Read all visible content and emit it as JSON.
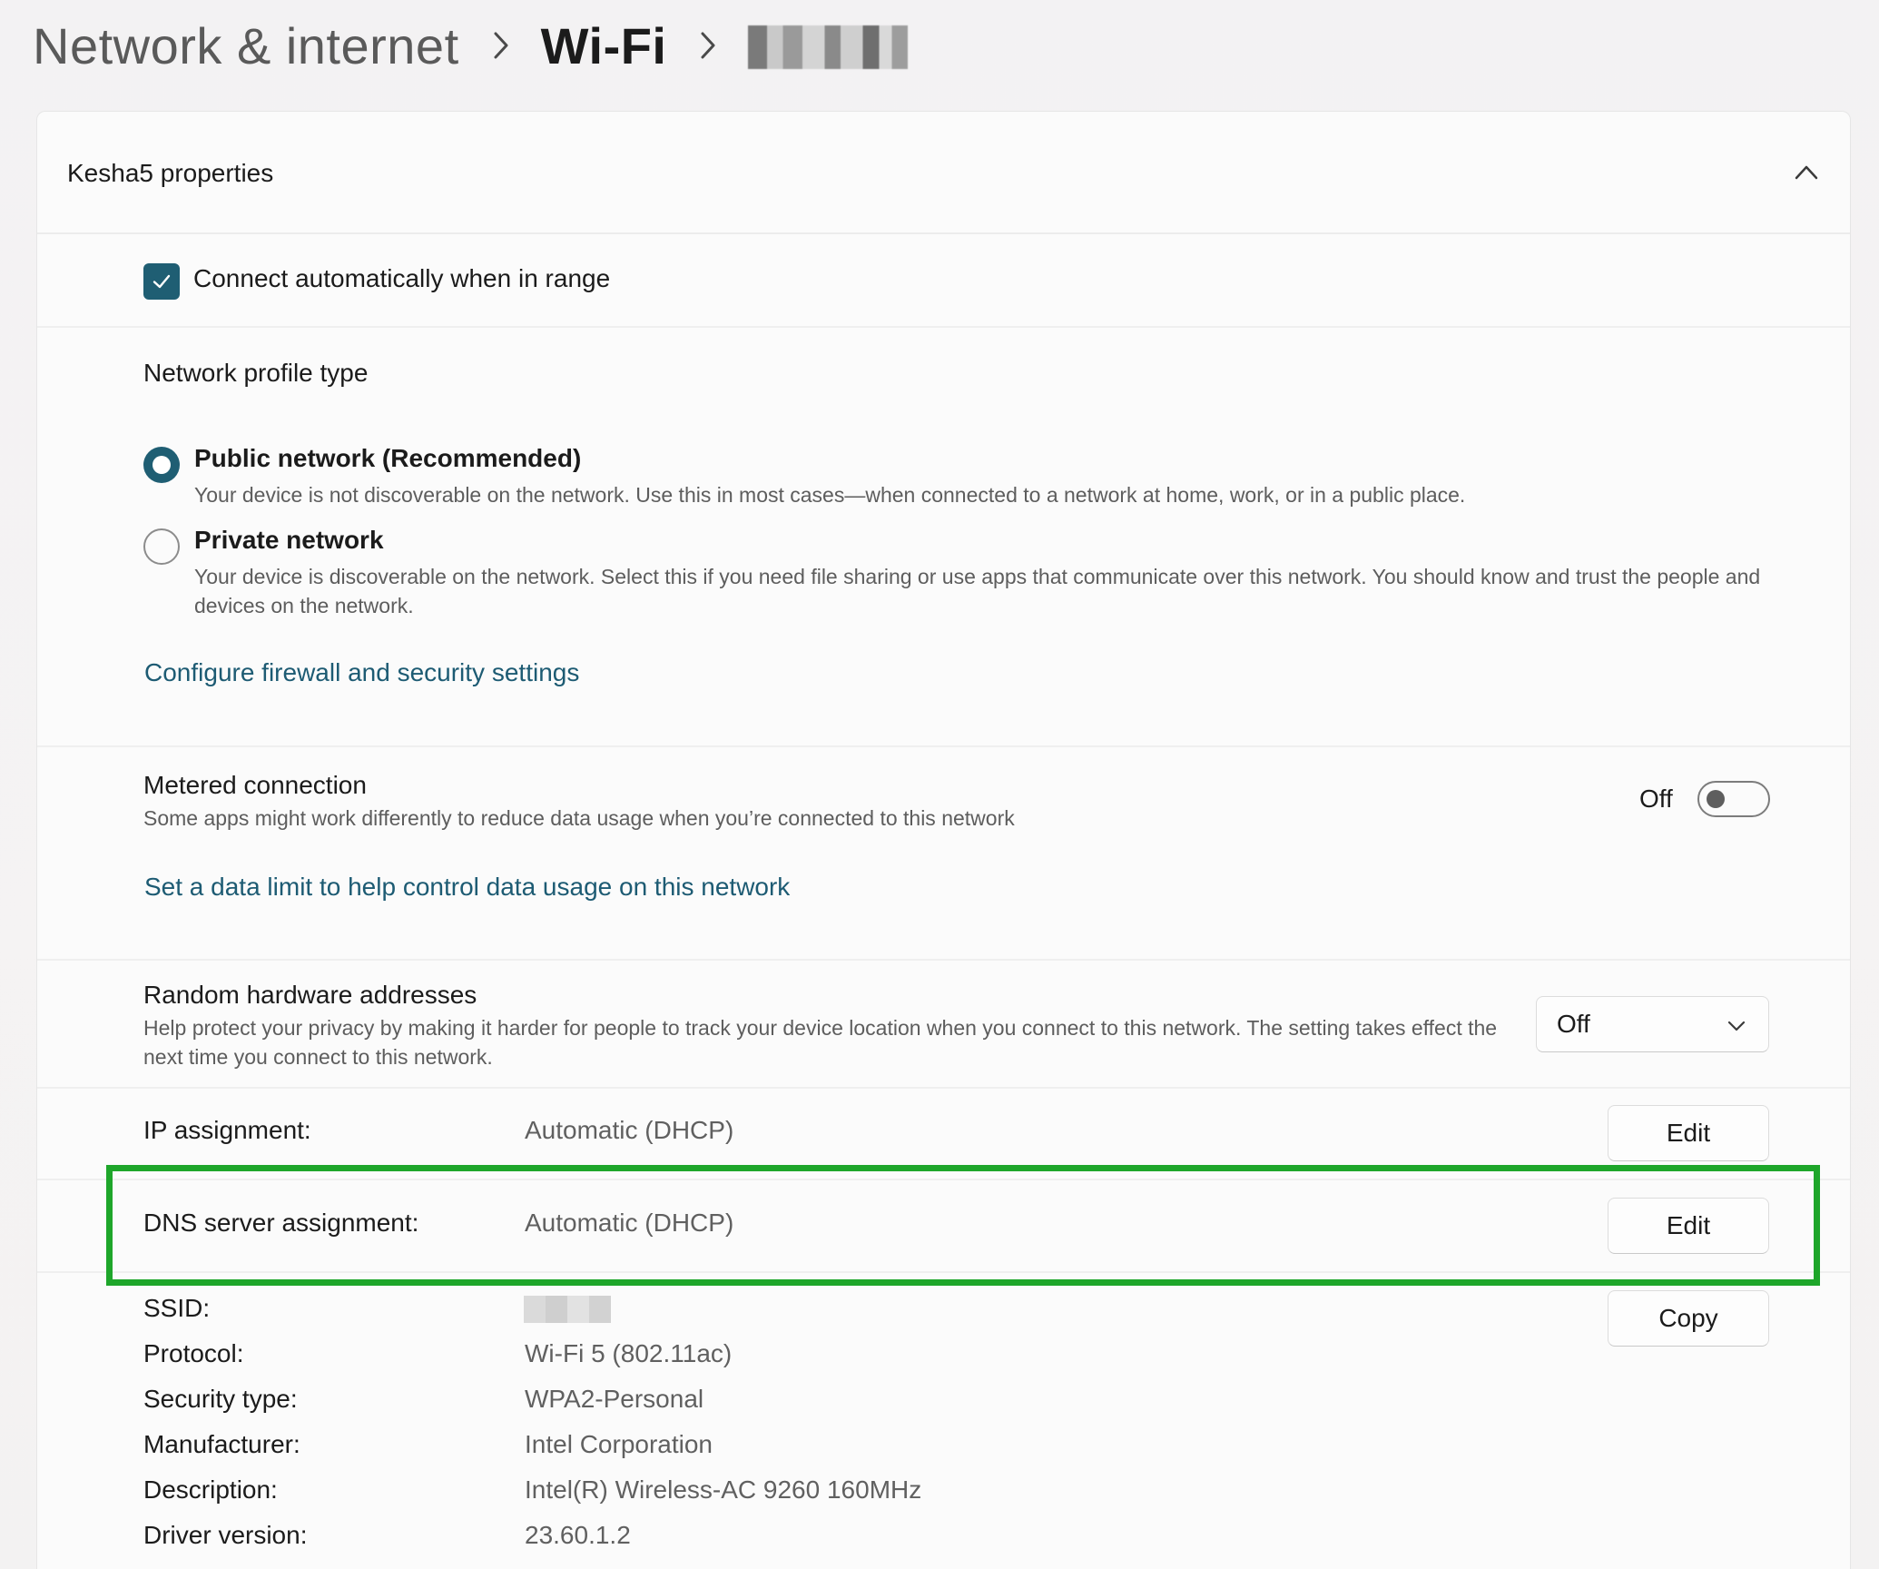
{
  "breadcrumb": {
    "parent": "Network & internet",
    "current": "Wi-Fi",
    "separator": "›"
  },
  "card": {
    "title": "Kesha5 properties",
    "collapse_icon": "chevron-up-icon"
  },
  "connect_auto": {
    "label": "Connect automatically when in range",
    "checked": true
  },
  "profile": {
    "heading": "Network profile type",
    "public": {
      "label": "Public network (Recommended)",
      "description": "Your device is not discoverable on the network. Use this in most cases—when connected to a network at home, work, or in a public place.",
      "selected": true
    },
    "private": {
      "label": "Private network",
      "description": "Your device is discoverable on the network. Select this if you need file sharing or use apps that communicate over this network. You should know and trust the people and devices on the network.",
      "selected": false
    },
    "firewall_link": "Configure firewall and security settings"
  },
  "metered": {
    "title": "Metered connection",
    "description": "Some apps might work differently to reduce data usage when you’re connected to this network",
    "state_label": "Off",
    "enabled": false,
    "data_limit_link": "Set a data limit to help control data usage on this network"
  },
  "random_hw": {
    "title": "Random hardware addresses",
    "description": "Help protect your privacy by making it harder for people to track your device location when you connect to this network. The setting takes effect the next time you connect to this network.",
    "selected_value": "Off"
  },
  "ip_assignment": {
    "label": "IP assignment:",
    "value": "Automatic (DHCP)",
    "button": "Edit"
  },
  "dns_assignment": {
    "label": "DNS server assignment:",
    "value": "Automatic (DHCP)",
    "button": "Edit"
  },
  "details": {
    "copy_button": "Copy",
    "ssid_label": "SSID:",
    "rows": [
      {
        "label": "Protocol:",
        "value": "Wi-Fi 5 (802.11ac)"
      },
      {
        "label": "Security type:",
        "value": "WPA2-Personal"
      },
      {
        "label": "Manufacturer:",
        "value": "Intel Corporation"
      },
      {
        "label": "Description:",
        "value": "Intel(R) Wireless-AC 9260 160MHz"
      },
      {
        "label": "Driver version:",
        "value": "23.60.1.2"
      }
    ]
  },
  "colors": {
    "accent": "#1f5e73",
    "link": "#1d5b73",
    "highlight_box": "#1ea62a"
  }
}
